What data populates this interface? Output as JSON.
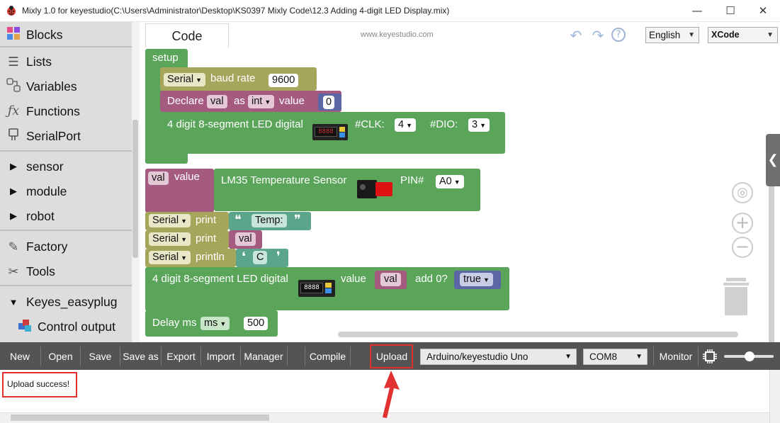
{
  "window": {
    "title": "Mixly 1.0 for keyestudio(C:\\Users\\Administrator\\Desktop\\KS0397 Mixly Code\\12.3 Adding 4-digit LED Display.mix)",
    "minimize": "—",
    "maximize": "☐",
    "close": "✕"
  },
  "sidebar": {
    "items": [
      {
        "label": "Blocks",
        "icon": "puzzle-icon"
      },
      {
        "label": "Lists",
        "icon": "list-icon"
      },
      {
        "label": "Variables",
        "icon": "variables-icon"
      },
      {
        "label": "Functions",
        "icon": "function-icon"
      },
      {
        "label": "SerialPort",
        "icon": "serial-icon"
      },
      {
        "label": "sensor",
        "icon": "triangle-right-icon"
      },
      {
        "label": "module",
        "icon": "triangle-right-icon"
      },
      {
        "label": "robot",
        "icon": "triangle-right-icon"
      },
      {
        "label": "Factory",
        "icon": "pen-icon"
      },
      {
        "label": "Tools",
        "icon": "tools-icon"
      },
      {
        "label": "Keyes_easyplug",
        "icon": "triangle-down-icon"
      },
      {
        "label": "Control output",
        "icon": "blocks-icon"
      }
    ]
  },
  "workspace": {
    "tab": "Code",
    "site": "www.keyestudio.com",
    "language": "English",
    "theme": "XCode",
    "collapse": "❮"
  },
  "blocks": {
    "setup": "setup",
    "serial": "Serial",
    "baud_rate": "baud rate",
    "baud_value": "9600",
    "declare": "Declare",
    "var_val": "val",
    "as": "as",
    "int": "int",
    "value": "value",
    "zero": "0",
    "led_digital": "4 digit 8-segment LED digital",
    "clk": "#CLK:",
    "clk_value": "4",
    "dio": "#DIO:",
    "dio_value": "3",
    "val_value": "value",
    "lm35": "LM35 Temperature Sensor",
    "pin": "PIN#",
    "pin_value": "A0",
    "print": "print",
    "temp_open": "❝",
    "temp_text": "Temp:",
    "temp_close": "❞",
    "println": "println",
    "c_open": "❛",
    "c_text": "C",
    "c_close": "❜",
    "add0": "add 0?",
    "true": "true",
    "delay": "Delay ms",
    "ms": "ms",
    "delay_value": "500"
  },
  "toolbar": {
    "new": "New",
    "open": "Open",
    "save": "Save",
    "save_as": "Save as",
    "export": "Export",
    "import": "Import",
    "manager": "Manager",
    "compile": "Compile",
    "upload": "Upload",
    "board": "Arduino/keyestudio Uno",
    "port": "COM8",
    "monitor": "Monitor"
  },
  "output": {
    "text": "Upload success!"
  },
  "colors": {
    "setup_green": "#5ba55b",
    "serial_olive": "#a5a55b",
    "variable_purple": "#a55b80",
    "math_blue": "#5b67a5",
    "text_teal": "#5ba58c",
    "highlight_red": "#e03030"
  }
}
